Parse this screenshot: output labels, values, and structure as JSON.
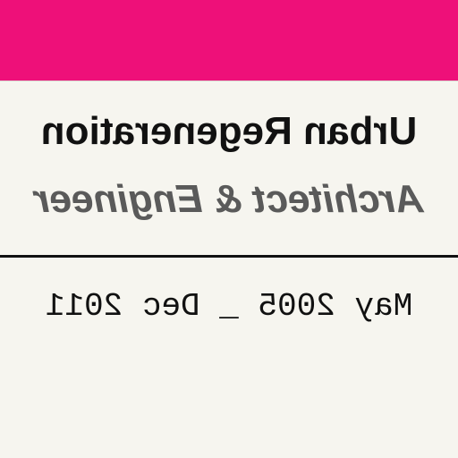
{
  "colors": {
    "accent": "#ee1079",
    "background": "#f6f5ef",
    "text_primary": "#111111",
    "text_secondary": "#5a5a5a"
  },
  "card": {
    "organization": "Urban Regeneration",
    "role": "Architect & Engineer",
    "period": "May 2005 _ Dec 2011"
  }
}
